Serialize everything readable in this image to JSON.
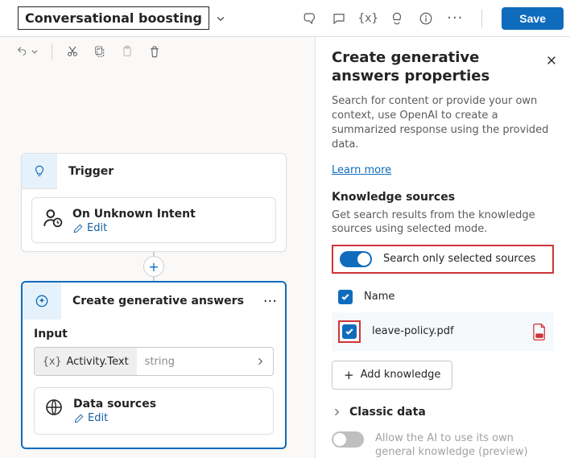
{
  "topbar": {
    "topic_name": "Conversational boosting",
    "save_label": "Save"
  },
  "canvas": {
    "trigger_label": "Trigger",
    "on_unknown": "On Unknown Intent",
    "edit_label": "Edit",
    "gen_answers_label": "Create generative answers",
    "input_label": "Input",
    "input_var": "Activity.Text",
    "input_type": "string",
    "data_sources_label": "Data sources"
  },
  "panel": {
    "title": "Create generative answers properties",
    "desc": "Search for content or provide your own context, use OpenAI to create a summarized response using the provided data.",
    "learn_more": "Learn more",
    "ks_title": "Knowledge sources",
    "ks_desc": "Get search results from the knowledge sources using selected mode.",
    "toggle_label": "Search only selected sources",
    "col_name": "Name",
    "source1": "leave-policy.pdf",
    "add_knowledge": "Add knowledge",
    "classic_data": "Classic data",
    "allow_ai": "Allow the AI to use its own general knowledge (preview)"
  }
}
